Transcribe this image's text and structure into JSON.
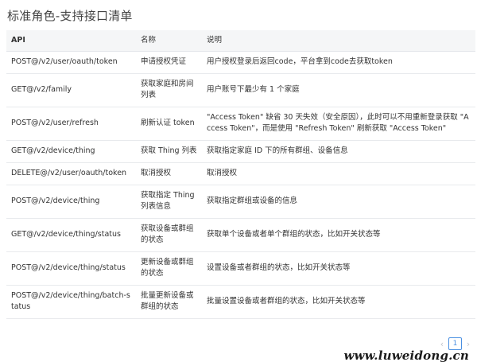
{
  "page": {
    "title": "标准角色-支持接口清单"
  },
  "table": {
    "headers": {
      "api": "API",
      "name": "名称",
      "desc": "说明"
    },
    "rows": [
      {
        "api": "POST@/v2/user/oauth/token",
        "name": "申请授权凭证",
        "desc": "用户授权登录后返回code，平台拿到code去获取token"
      },
      {
        "api": "GET@/v2/family",
        "name": "获取家庭和房间列表",
        "desc": "用户账号下最少有 1 个家庭"
      },
      {
        "api": "POST@/v2/user/refresh",
        "name": "刷新认证 token",
        "desc": "\"Access Token\" 缺省 30 天失效（安全原因），此时可以不用重新登录获取 \"Access Token\"，而是使用 \"Refresh Token\" 刷新获取 \"Access Token\""
      },
      {
        "api": "GET@/v2/device/thing",
        "name": "获取 Thing 列表",
        "desc": "获取指定家庭 ID 下的所有群组、设备信息"
      },
      {
        "api": "DELETE@/v2/user/oauth/token",
        "name": "取消授权",
        "desc": "取消授权"
      },
      {
        "api": "POST@/v2/device/thing",
        "name": "获取指定 Thing 列表信息",
        "desc": "获取指定群组或设备的信息"
      },
      {
        "api": "GET@/v2/device/thing/status",
        "name": "获取设备或群组的状态",
        "desc": "获取单个设备或者单个群组的状态，比如开关状态等"
      },
      {
        "api": "POST@/v2/device/thing/status",
        "name": "更新设备或群组的状态",
        "desc": "设置设备或者群组的状态，比如开关状态等"
      },
      {
        "api": "POST@/v2/device/thing/batch-status",
        "name": "批量更新设备或群组的状态",
        "desc": "批量设置设备或者群组的状态，比如开关状态等"
      }
    ]
  },
  "pagination": {
    "prev_icon": "chevron-left-icon",
    "current_page": "1",
    "next_icon": "chevron-right-icon"
  },
  "watermark": "www.luweidong.cn"
}
